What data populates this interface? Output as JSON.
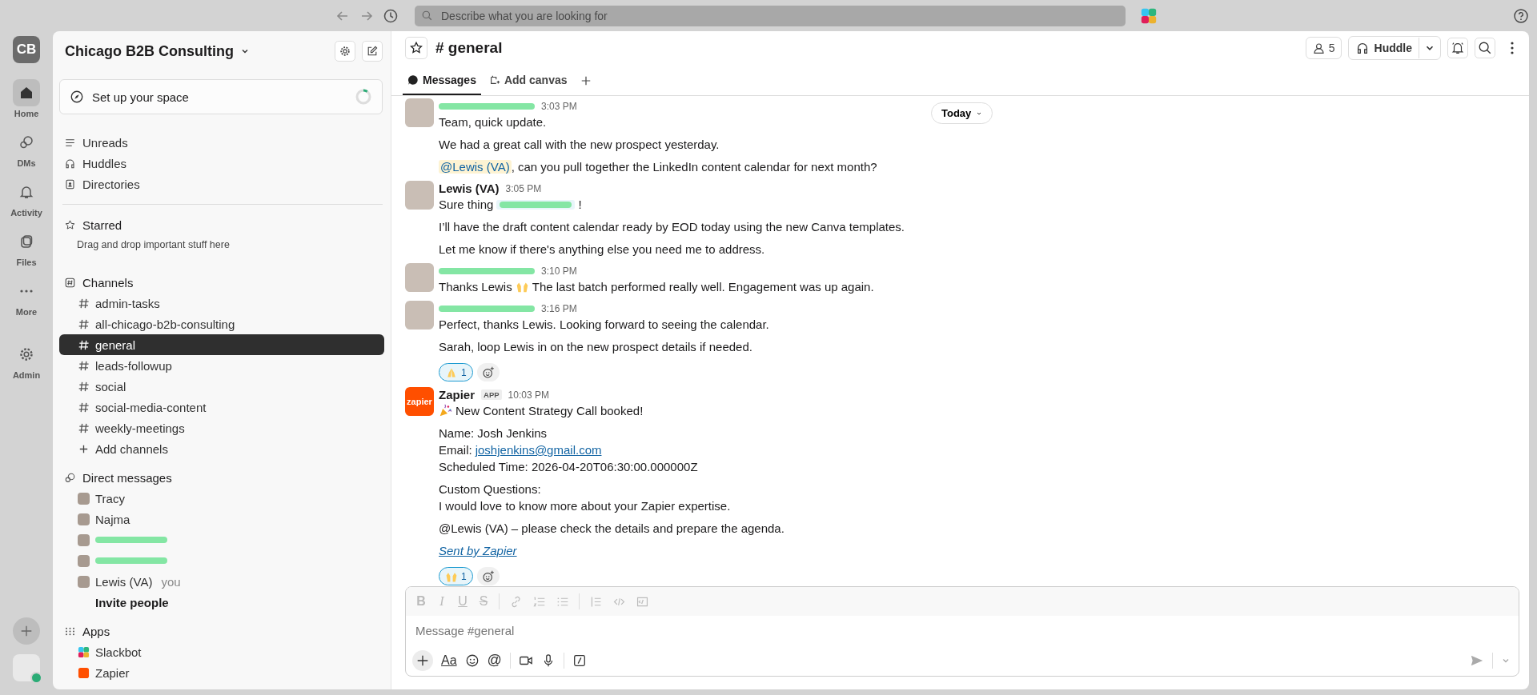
{
  "top_bar": {
    "search_placeholder": "Describe what you are looking for"
  },
  "rail": {
    "workspace_initials": "CB",
    "items": [
      {
        "kind": "home",
        "label": "Home",
        "selected": true
      },
      {
        "kind": "dms",
        "label": "DMs",
        "selected": false
      },
      {
        "kind": "activity",
        "label": "Activity",
        "selected": false
      },
      {
        "kind": "files",
        "label": "Files",
        "selected": false
      },
      {
        "kind": "more",
        "label": "More",
        "selected": false
      },
      {
        "kind": "admin",
        "label": "Admin",
        "selected": false
      }
    ]
  },
  "sidebar": {
    "workspace": "Chicago B2B Consulting",
    "setup": {
      "label": "Set up your space",
      "level": 0.1
    },
    "nav": [
      {
        "kind": "unreads",
        "label": "Unreads"
      },
      {
        "kind": "huddles",
        "label": "Huddles"
      },
      {
        "kind": "directories",
        "label": "Directories"
      }
    ],
    "starred": {
      "title": "Starred",
      "hint": "Drag and drop important stuff here"
    },
    "channels": {
      "title": "Channels",
      "add": "Add channels",
      "items": [
        {
          "name": "admin-tasks",
          "selected": false
        },
        {
          "name": "all-chicago-b2b-consulting",
          "selected": false
        },
        {
          "name": "general",
          "selected": true
        },
        {
          "name": "leads-followup",
          "selected": false
        },
        {
          "name": "social",
          "selected": false
        },
        {
          "name": "social-media-content",
          "selected": false
        },
        {
          "name": "weekly-meetings",
          "selected": false
        }
      ]
    },
    "direct_messages": {
      "title": "Direct messages",
      "invite": "Invite people",
      "items": [
        {
          "name": "Tracy",
          "redacted": false
        },
        {
          "name": "Najma",
          "redacted": false
        },
        {
          "redacted": true
        },
        {
          "redacted": true
        },
        {
          "name": "Lewis (VA)",
          "suffix": "you",
          "redacted": false
        }
      ]
    },
    "apps": {
      "title": "Apps",
      "items": [
        {
          "kind": "slackbot",
          "name": "Slackbot"
        },
        {
          "kind": "zapier",
          "name": "Zapier"
        }
      ]
    }
  },
  "channel": {
    "title": "# general",
    "members": "5",
    "huddle": "Huddle",
    "tabs": [
      {
        "kind": "messages",
        "label": "Messages",
        "selected": true
      },
      {
        "kind": "canvas",
        "label": "Add canvas",
        "selected": false
      }
    ],
    "date_pill": "Today",
    "messages": [
      {
        "kind": "user",
        "redacted": true,
        "time": "3:03 PM",
        "paragraphs": [
          [
            [
              {
                "kind": "text",
                "text": "Team, quick update."
              }
            ]
          ],
          [
            [
              {
                "kind": "text",
                "text": "We had a great call with the new prospect yesterday."
              }
            ]
          ],
          [
            [
              {
                "kind": "mention",
                "text": "@Lewis (VA)"
              },
              {
                "kind": "text",
                "text": ", can you pull together the LinkedIn content calendar for next month?"
              }
            ]
          ]
        ]
      },
      {
        "kind": "user",
        "redacted": false,
        "author": "Lewis (VA)",
        "time": "3:05 PM",
        "paragraphs": [
          [
            [
              {
                "kind": "text",
                "text": "Sure thing"
              },
              {
                "kind": "redacted-mention"
              },
              {
                "kind": "text",
                "text": "!"
              }
            ]
          ],
          [
            [
              {
                "kind": "text",
                "text": "I’ll have the draft content calendar ready by EOD today using the new Canva templates."
              }
            ]
          ],
          [
            [
              {
                "kind": "text",
                "text": "Let me know if there's anything else you need me to address."
              }
            ]
          ]
        ]
      },
      {
        "kind": "user",
        "redacted": true,
        "time": "3:10 PM",
        "paragraphs": [
          [
            [
              {
                "kind": "text",
                "text": "Thanks Lewis"
              },
              {
                "kind": "emoji-raised-hands"
              },
              {
                "kind": "text",
                "text": "The last batch performed really well. Engagement was up again."
              }
            ]
          ]
        ]
      },
      {
        "kind": "user",
        "redacted": true,
        "time": "3:16 PM",
        "paragraphs": [
          [
            [
              {
                "kind": "text",
                "text": "Perfect, thanks Lewis. Looking forward to seeing the calendar."
              }
            ]
          ],
          [
            [
              {
                "kind": "text",
                "text": "Sarah, loop Lewis in on the new prospect details if needed."
              }
            ]
          ]
        ],
        "reactions": [
          {
            "kind": "pray",
            "count": "1",
            "selected": true
          }
        ]
      },
      {
        "kind": "app",
        "redacted": false,
        "author": "Zapier",
        "badge": "APP",
        "logo_text": "zapier",
        "time": "10:03 PM",
        "paragraphs": [
          [
            [
              {
                "kind": "emoji-party"
              },
              {
                "kind": "text",
                "text": "New Content Strategy Call booked!"
              }
            ]
          ],
          [
            [
              {
                "kind": "text",
                "text": "Name: Josh Jenkins"
              }
            ],
            [
              {
                "kind": "text",
                "text": "Email:"
              },
              {
                "kind": "link",
                "text": "joshjenkins@gmail.com"
              }
            ],
            [
              {
                "kind": "text",
                "text": "Scheduled Time: 2026-04-20T06:30:00.000000Z"
              }
            ]
          ],
          [
            [
              {
                "kind": "text",
                "text": "Custom Questions:"
              }
            ],
            [
              {
                "kind": "text",
                "text": "I would love to know more about your Zapier expertise."
              }
            ]
          ],
          [
            [
              {
                "kind": "text",
                "text": "@Lewis (VA) – please check the details and prepare the agenda."
              }
            ]
          ],
          [
            [
              {
                "kind": "signature",
                "text": "Sent by Zapier"
              }
            ]
          ]
        ],
        "reactions": [
          {
            "kind": "raised-hands",
            "count": "1",
            "selected": true
          }
        ]
      }
    ],
    "composer": {
      "placeholder": "Message #general",
      "format_buttons": [
        "B",
        "I",
        "U",
        "S"
      ],
      "text_button": "Aa",
      "mention_button": "@"
    }
  }
}
